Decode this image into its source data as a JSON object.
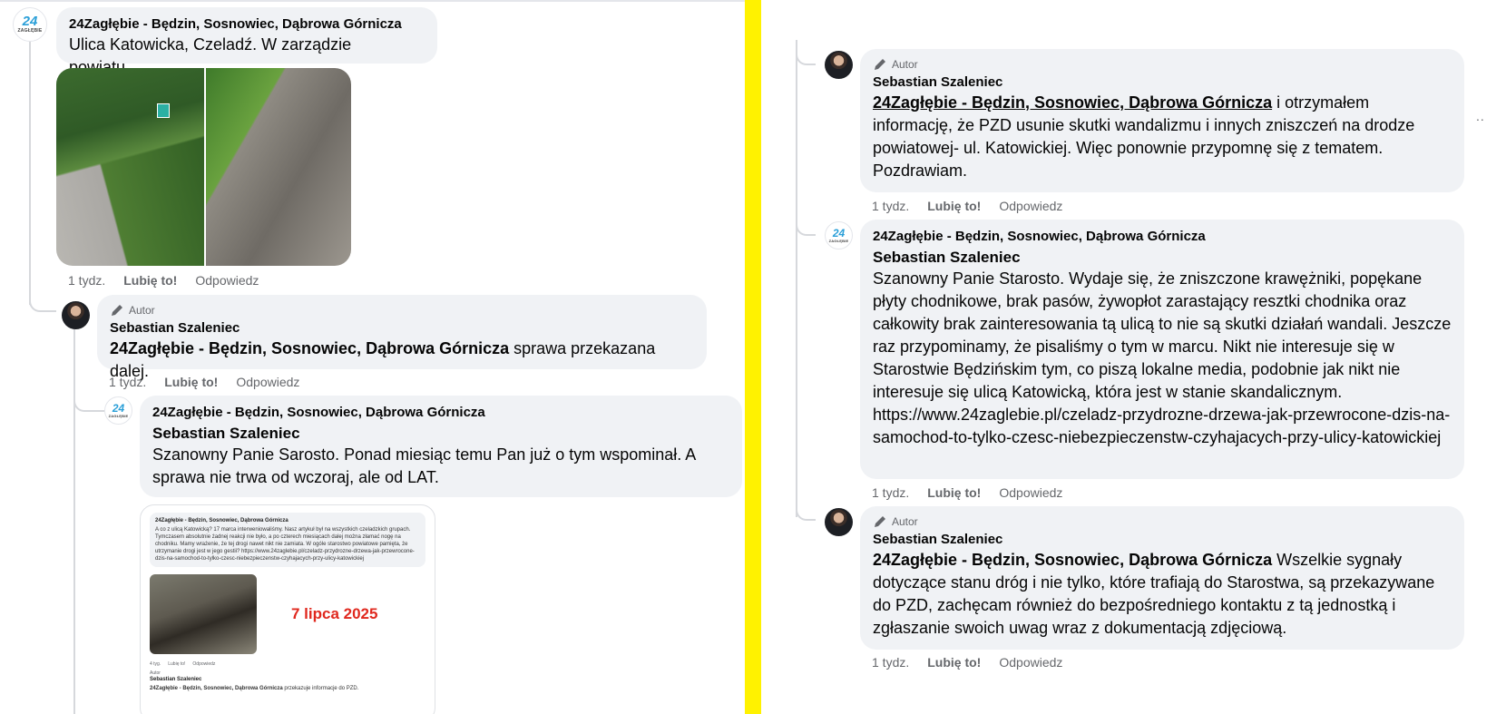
{
  "page_name": "24Zagłębie - Będzin, Sosnowiec, Dąbrowa Górnicza",
  "author_person": "Sebastian Szaleniec",
  "author_badge": "Autor",
  "actions": {
    "time": "1 tydz.",
    "like": "Lubię to!",
    "reply": "Odpowiedz"
  },
  "brand_avatar": {
    "num": "24",
    "word": "ZAGŁĘBIE"
  },
  "left": {
    "c1": {
      "text": "Ulica Katowicka, Czeladź. W zarządzie powiatu..."
    },
    "c2": {
      "text": "sprawa przekazana dalej."
    },
    "c3": {
      "text": "Szanowny Panie Sarosto. Ponad miesiąc temu Pan już o tym wspominał. A sprawa nie trwa od wczoraj, ale od LAT."
    },
    "embedded": {
      "text": "A co z ulicą Katowicką? 17 marca interweniowaliśmy. Nasz artykuł był na wszystkich czeladzkich grupach. Tymczasem absolutnie żadnej reakcji nie było, a po czterech miesiącach dalej można złamać nogę na chodniku. Mamy wrażenie, że tej drogi nawet nikt nie zamiata. W ogóle starostwo powiatowe pamięta, że utrzymanie drogi jest w jego gestii? https://www.24zaglebie.pl/czeladz-przydrozne-drzewa-jak-przewrocone-dzis-na-samochod-to-tylko-czesc-niebezpieczenstw-czyhajacych-przy-ulicy-katowickiej",
      "date": "7 lipca 2025",
      "time": "4 tyg.",
      "author_text": "przekazuje informacje do PZD."
    }
  },
  "right": {
    "c1": {
      "text": "i otrzymałem informację, że PZD usunie skutki wandalizmu i innych zniszczeń na drodze powiatowej- ul. Katowickiej. Więc ponownie przypomnę się z tematem. Pozdrawiam."
    },
    "c2": {
      "text": "Szanowny Panie Starosto. Wydaje się, że zniszczone krawężniki, popękane płyty chodnikowe, brak pasów, żywopłot zarastający resztki chodnika oraz całkowity brak zainteresowania tą ulicą to nie są skutki działań wandali. Jeszcze raz przypominamy, że pisaliśmy o tym w marcu. Nikt nie interesuje się w Starostwie Będzińskim tym, co piszą lokalne media, podobnie jak nikt nie interesuje się ulicą Katowicką, która jest w stanie skandalicznym. https://www.24zaglebie.pl/czeladz-przydrozne-drzewa-jak-przewrocone-dzis-na-samochod-to-tylko-czesc-niebezpieczenstw-czyhajacych-przy-ulicy-katowickiej"
    },
    "c3": {
      "text": "Wszelkie sygnały dotyczące stanu dróg i nie tylko, które trafiają do Starostwa, są przekazywane do PZD, zachęcam również do bezpośredniego kontaktu z tą jednostką i zgłaszanie swoich uwag wraz z dokumentacją zdjęciową."
    },
    "more": ".."
  },
  "colors": {
    "divider": "#fff200",
    "bubble": "#f0f2f5",
    "muted": "#65676b",
    "date_red": "#e0281e"
  }
}
